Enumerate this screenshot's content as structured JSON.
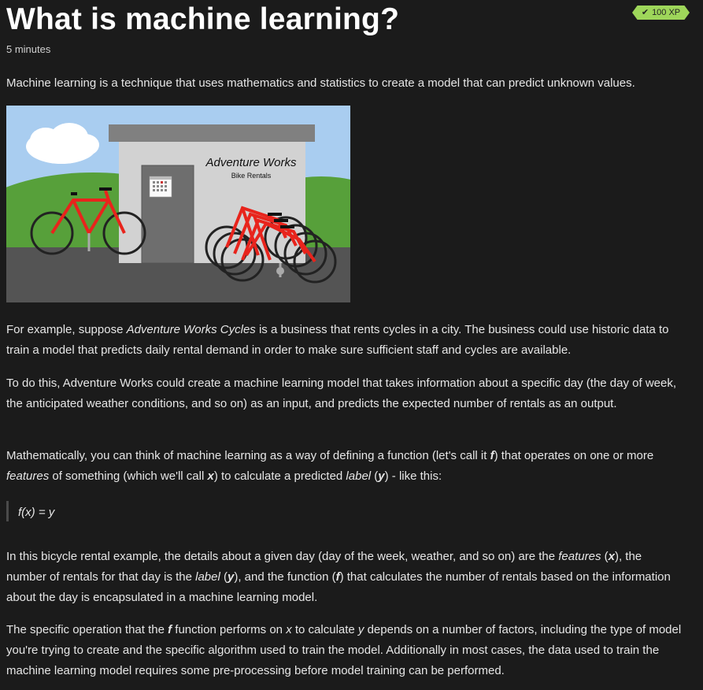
{
  "header": {
    "title": "What is machine learning?",
    "xp_badge": "100 XP",
    "duration": "5 minutes"
  },
  "illustration": {
    "sign_title": "Adventure Works",
    "sign_subtitle": "Bike Rentals"
  },
  "content": {
    "intro": "Machine learning is a technique that uses mathematics and statistics to create a model that can predict unknown values.",
    "p1": {
      "a": "For example, suppose ",
      "a_em": "Adventure Works Cycles",
      "b": " is a business that rents cycles in a city. The business could use historic data to train a model that predicts daily rental demand in order to make sure sufficient staff and cycles are available."
    },
    "p2": "To do this, Adventure Works could create a machine learning model that takes information about a specific day (the day of week, the anticipated weather conditions, and so on) as an input, and predicts the expected number of rentals as an output.",
    "p3": {
      "a": "Mathematically, you can think of machine learning as a way of defining a function (let's call it ",
      "f": "f",
      "b": ") that operates on one or more ",
      "features": "features",
      "c": " of something (which we'll call ",
      "x": "x",
      "d": ") to calculate a predicted ",
      "label": "label",
      "e": " (",
      "y": "y",
      "g": ") - like this:"
    },
    "formula": "f(x) = y",
    "p4": {
      "a": "In this bicycle rental example, the details about a given day (day of the week, weather, and so on) are the ",
      "features": "features",
      "b": " (",
      "x": "x",
      "c": "), the number of rentals for that day is the ",
      "label": "label",
      "d": " (",
      "y": "y",
      "e": "), and the function (",
      "f": "f",
      "g": ") that calculates the number of rentals based on the information about the day is encapsulated in a machine learning model."
    },
    "p5": {
      "a": "The specific operation that the ",
      "f": "f",
      "b": " function performs on ",
      "x": "x",
      "c": " to calculate ",
      "y": "y",
      "d": " depends on a number of factors, including the type of model you're trying to create and the specific algorithm used to train the model. Additionally in most cases, the data used to train the machine learning model requires some pre-processing before model training can be performed."
    }
  },
  "colors": {
    "background": "#1b1b1b",
    "text": "#e6e6e6",
    "badge": "#9ed65a",
    "sky": "#a9cdf0",
    "grass": "#57a03a",
    "bike": "#e8241c"
  }
}
